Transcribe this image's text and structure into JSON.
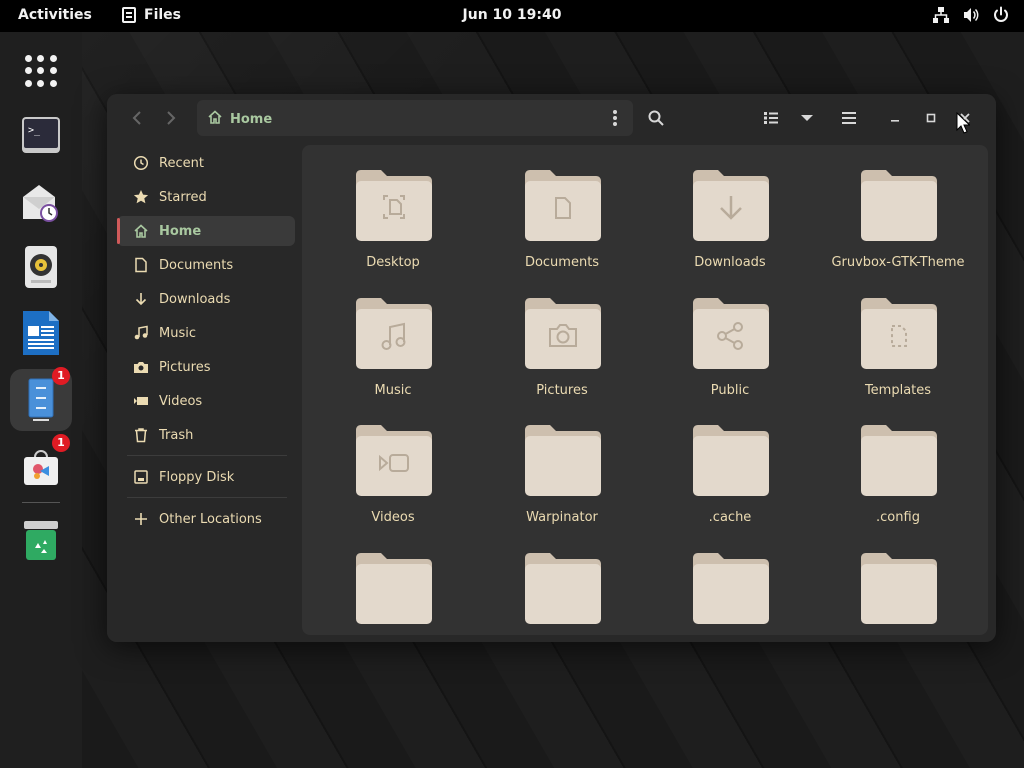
{
  "topbar": {
    "activities": "Activities",
    "app_name": "Files",
    "clock": "Jun 10  19:40",
    "tray_icons": [
      "network-icon",
      "volume-icon",
      "power-icon"
    ]
  },
  "dock": {
    "items": [
      {
        "name": "app-grid-icon"
      },
      {
        "name": "terminal-icon"
      },
      {
        "name": "mail-clock-icon"
      },
      {
        "name": "music-player-icon"
      },
      {
        "name": "writer-document-icon"
      },
      {
        "name": "files-icon",
        "badge": "1",
        "active": true
      },
      {
        "name": "software-store-icon",
        "badge": "1"
      },
      {
        "name": "trash-dock-icon"
      }
    ]
  },
  "window": {
    "path": "Home",
    "sidebar": [
      {
        "label": "Recent",
        "icon": "clock-icon"
      },
      {
        "label": "Starred",
        "icon": "star-icon"
      },
      {
        "label": "Home",
        "icon": "home-icon",
        "active": true
      },
      {
        "label": "Documents",
        "icon": "document-icon"
      },
      {
        "label": "Downloads",
        "icon": "download-icon"
      },
      {
        "label": "Music",
        "icon": "music-icon"
      },
      {
        "label": "Pictures",
        "icon": "camera-icon"
      },
      {
        "label": "Videos",
        "icon": "video-icon"
      },
      {
        "label": "Trash",
        "icon": "trash-icon"
      },
      {
        "label": "Floppy Disk",
        "icon": "disk-icon"
      },
      {
        "label": "Other Locations",
        "icon": "plus-icon"
      }
    ],
    "folders": [
      {
        "label": "Desktop",
        "emblem": "desktop"
      },
      {
        "label": "Documents",
        "emblem": "document"
      },
      {
        "label": "Downloads",
        "emblem": "download"
      },
      {
        "label": "Gruvbox-GTK-Theme",
        "emblem": ""
      },
      {
        "label": "Music",
        "emblem": "music"
      },
      {
        "label": "Pictures",
        "emblem": "camera"
      },
      {
        "label": "Public",
        "emblem": "share"
      },
      {
        "label": "Templates",
        "emblem": "template"
      },
      {
        "label": "Videos",
        "emblem": "video"
      },
      {
        "label": "Warpinator",
        "emblem": ""
      },
      {
        "label": ".cache",
        "emblem": ""
      },
      {
        "label": ".config",
        "emblem": ""
      },
      {
        "label": "",
        "emblem": ""
      },
      {
        "label": "",
        "emblem": ""
      },
      {
        "label": "",
        "emblem": ""
      },
      {
        "label": "",
        "emblem": ""
      }
    ]
  },
  "colors": {
    "accent": "#a9c8a0",
    "folder": "#e3d9cc",
    "folder_tab": "#cdbfae",
    "emblem": "#b8ab9a"
  }
}
